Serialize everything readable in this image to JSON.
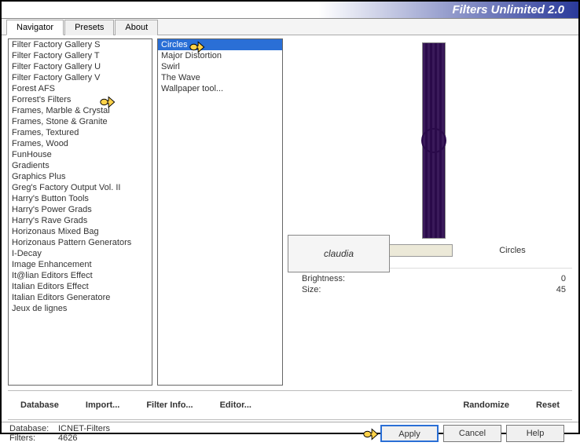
{
  "title": "Filters Unlimited 2.0",
  "tabs": [
    "Navigator",
    "Presets",
    "About"
  ],
  "active_tab": 0,
  "categories": [
    "Filter Factory Gallery S",
    "Filter Factory Gallery T",
    "Filter Factory Gallery U",
    "Filter Factory Gallery V",
    "Forest AFS",
    "Forrest's Filters",
    "Frames, Marble & Crystal",
    "Frames, Stone & Granite",
    "Frames, Textured",
    "Frames, Wood",
    "FunHouse",
    "Gradients",
    "Graphics Plus",
    "Greg's Factory Output Vol. II",
    "Harry's Button Tools",
    "Harry's Power Grads",
    "Harry's Rave Grads",
    "Horizonaus Mixed Bag",
    "Horizonaus Pattern Generators",
    "I-Decay",
    "Image Enhancement",
    "It@lian Editors Effect",
    "Italian Editors Effect",
    "Italian Editors Generatore",
    "Jeux de lignes"
  ],
  "selected_category_index": 5,
  "filters": [
    "Circles",
    "Major Distortion",
    "Swirl",
    "The Wave",
    "Wallpaper tool..."
  ],
  "selected_filter_index": 0,
  "current_filter_name": "Circles",
  "watermark_text": "claudia",
  "params": [
    {
      "label": "Brightness:",
      "value": "0"
    },
    {
      "label": "Size:",
      "value": "45"
    }
  ],
  "btns_left": {
    "database": "Database",
    "import": "Import...",
    "filterinfo": "Filter Info...",
    "editor": "Editor..."
  },
  "btns_right": {
    "randomize": "Randomize",
    "reset": "Reset"
  },
  "status": {
    "db_label": "Database:",
    "db_value": "ICNET-Filters",
    "filters_label": "Filters:",
    "filters_value": "4626"
  },
  "dialog_buttons": {
    "apply": "Apply",
    "cancel": "Cancel",
    "help": "Help"
  }
}
